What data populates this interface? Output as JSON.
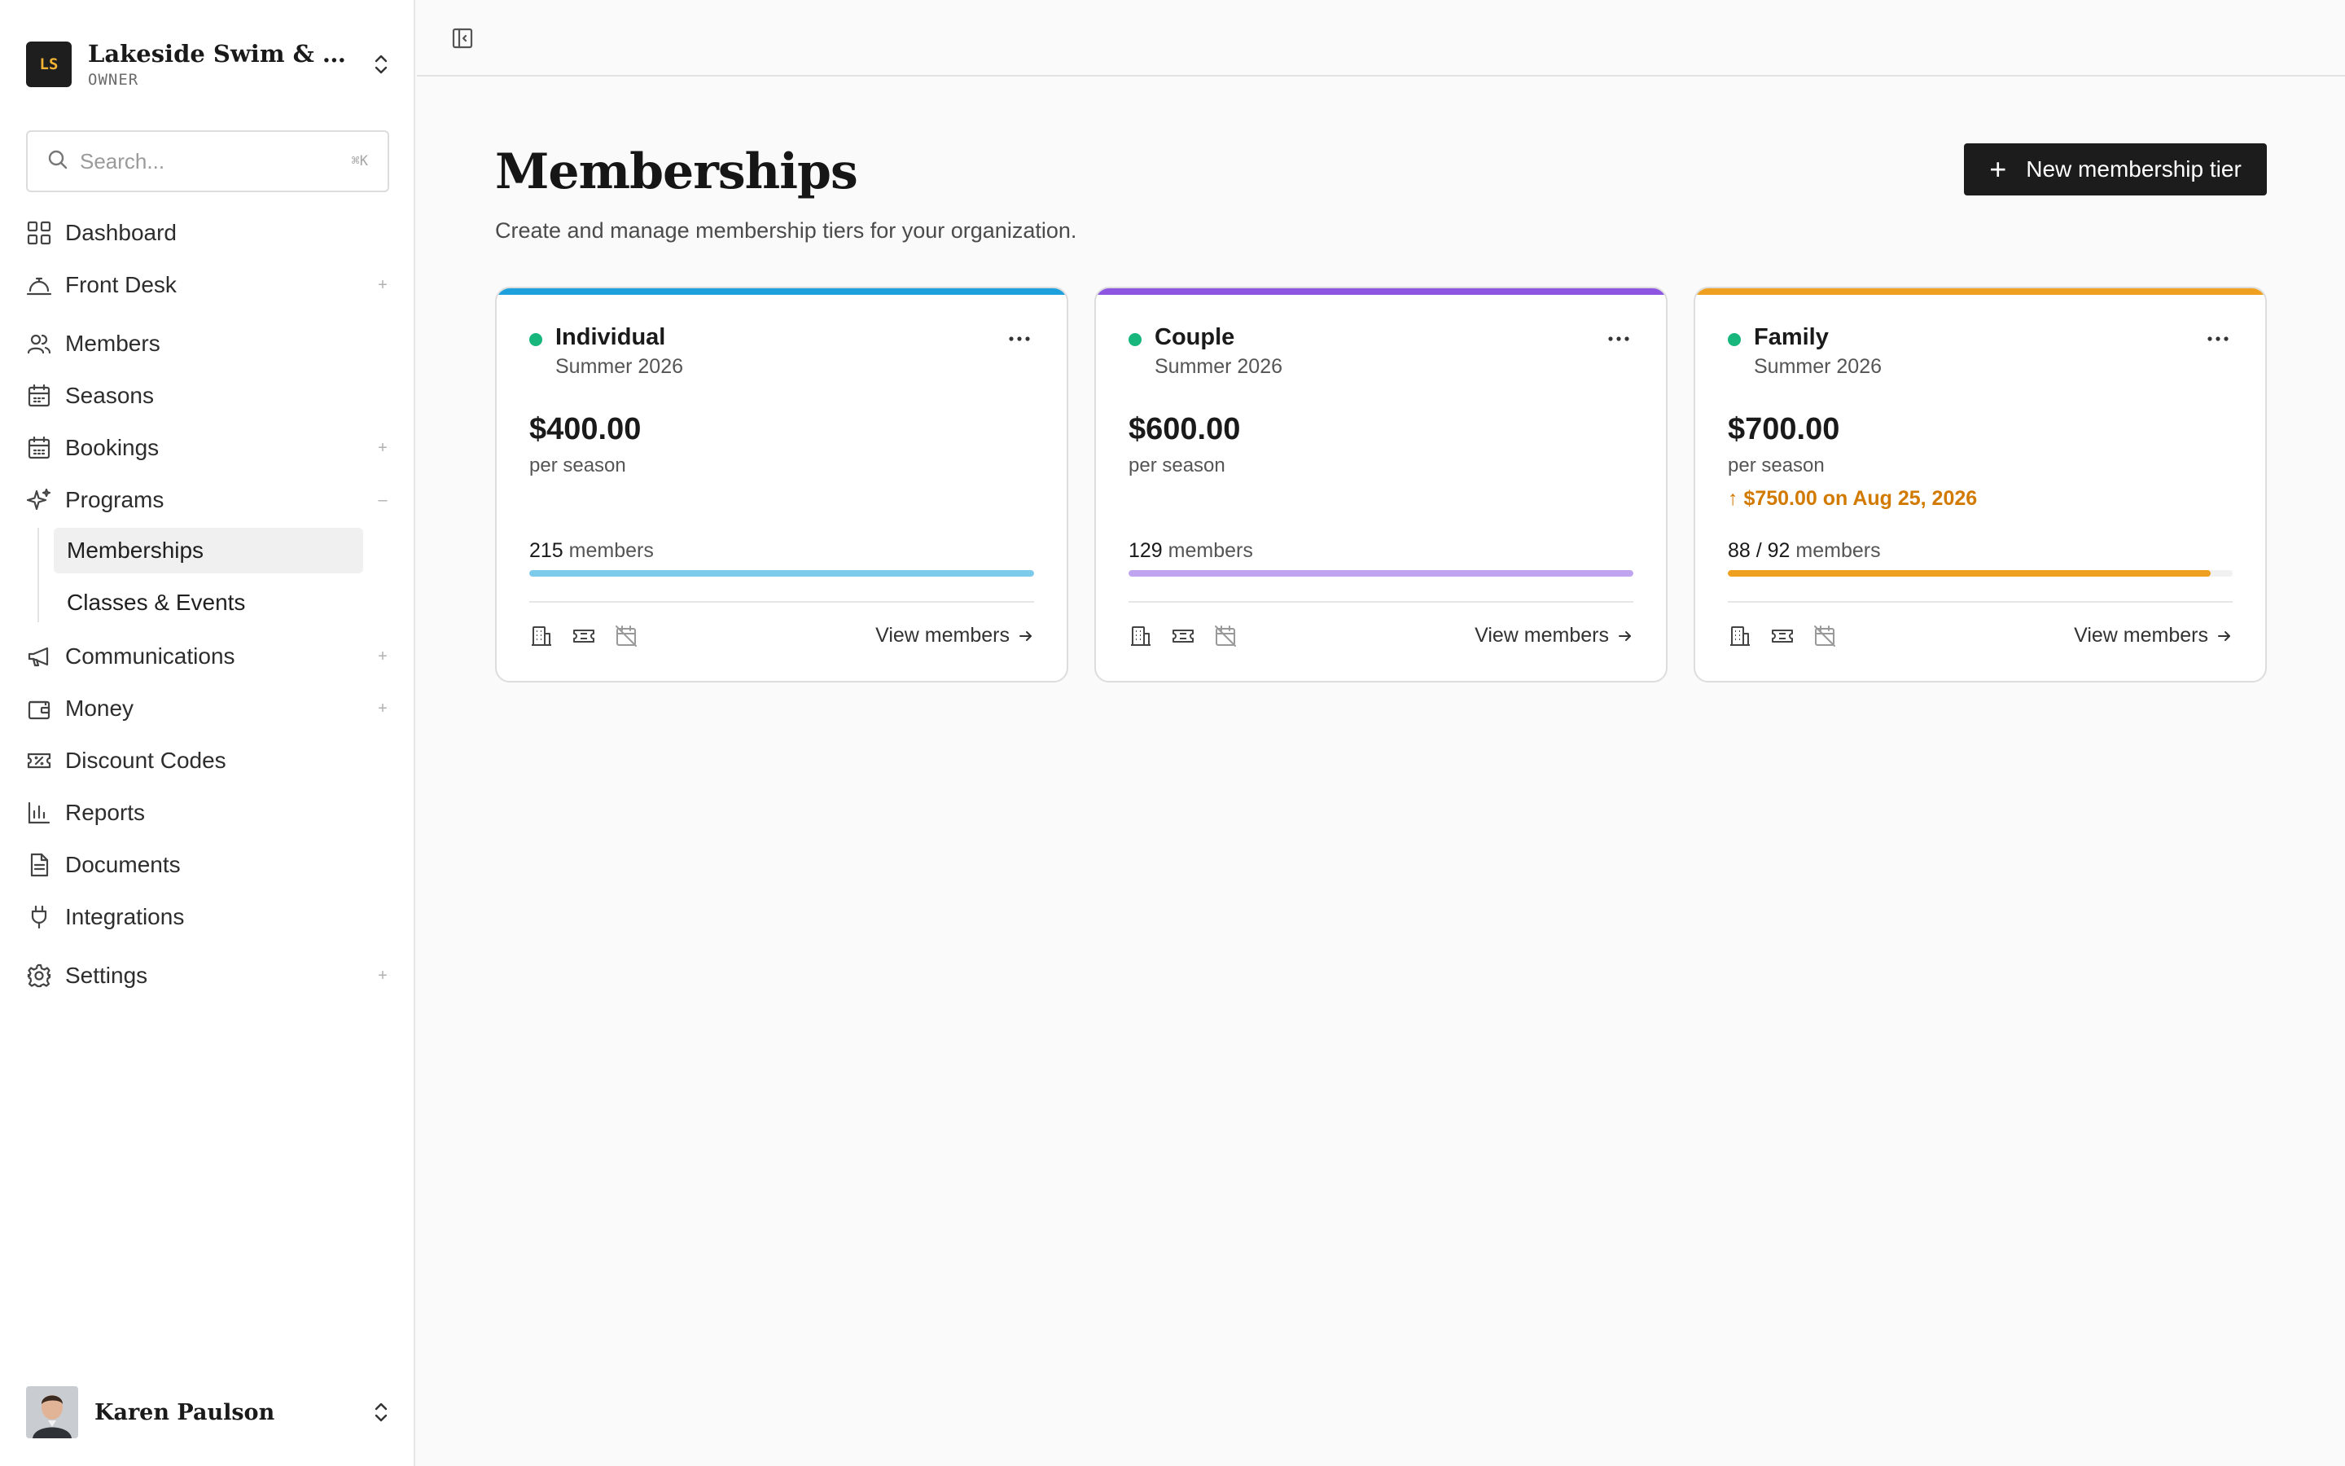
{
  "org": {
    "initials": "LS",
    "name": "Lakeside Swim & Ten...",
    "role": "OWNER"
  },
  "search": {
    "placeholder": "Search...",
    "shortcut": "⌘K"
  },
  "nav": {
    "dashboard": "Dashboard",
    "front_desk": "Front Desk",
    "members": "Members",
    "seasons": "Seasons",
    "bookings": "Bookings",
    "programs": "Programs",
    "programs_sub": [
      "Memberships",
      "Classes & Events"
    ],
    "communications": "Communications",
    "money": "Money",
    "discount_codes": "Discount Codes",
    "reports": "Reports",
    "documents": "Documents",
    "integrations": "Integrations",
    "settings": "Settings",
    "expand": "+",
    "collapse": "–"
  },
  "user": {
    "name": "Karen Paulson"
  },
  "page": {
    "title": "Memberships",
    "subtitle": "Create and manage membership tiers for your organization.",
    "new_button": "New membership tier",
    "new_button_icon": "+"
  },
  "colors": {
    "active_dot": "#16b67c",
    "individual": "#1ea0dc",
    "individual_fill": "#7ccbea",
    "couple": "#8e56e0",
    "couple_fill": "#c1a4ef",
    "family": "#f0a020",
    "family_fill": "#f0a020"
  },
  "tiers": [
    {
      "name": "Individual",
      "season": "Summer 2026",
      "price": "$400.00",
      "period": "per season",
      "upcoming": "",
      "members_count": "215",
      "members_label": "members",
      "capacity_fraction": 1.0,
      "view": "View members"
    },
    {
      "name": "Couple",
      "season": "Summer 2026",
      "price": "$600.00",
      "period": "per season",
      "upcoming": "",
      "members_count": "129",
      "members_label": "members",
      "capacity_fraction": 1.0,
      "view": "View members"
    },
    {
      "name": "Family",
      "season": "Summer 2026",
      "price": "$700.00",
      "period": "per season",
      "upcoming": "↑ $750.00 on Aug 25, 2026",
      "members_count": "88 / 92",
      "members_label": "members",
      "capacity_fraction": 0.9565,
      "view": "View members"
    }
  ]
}
